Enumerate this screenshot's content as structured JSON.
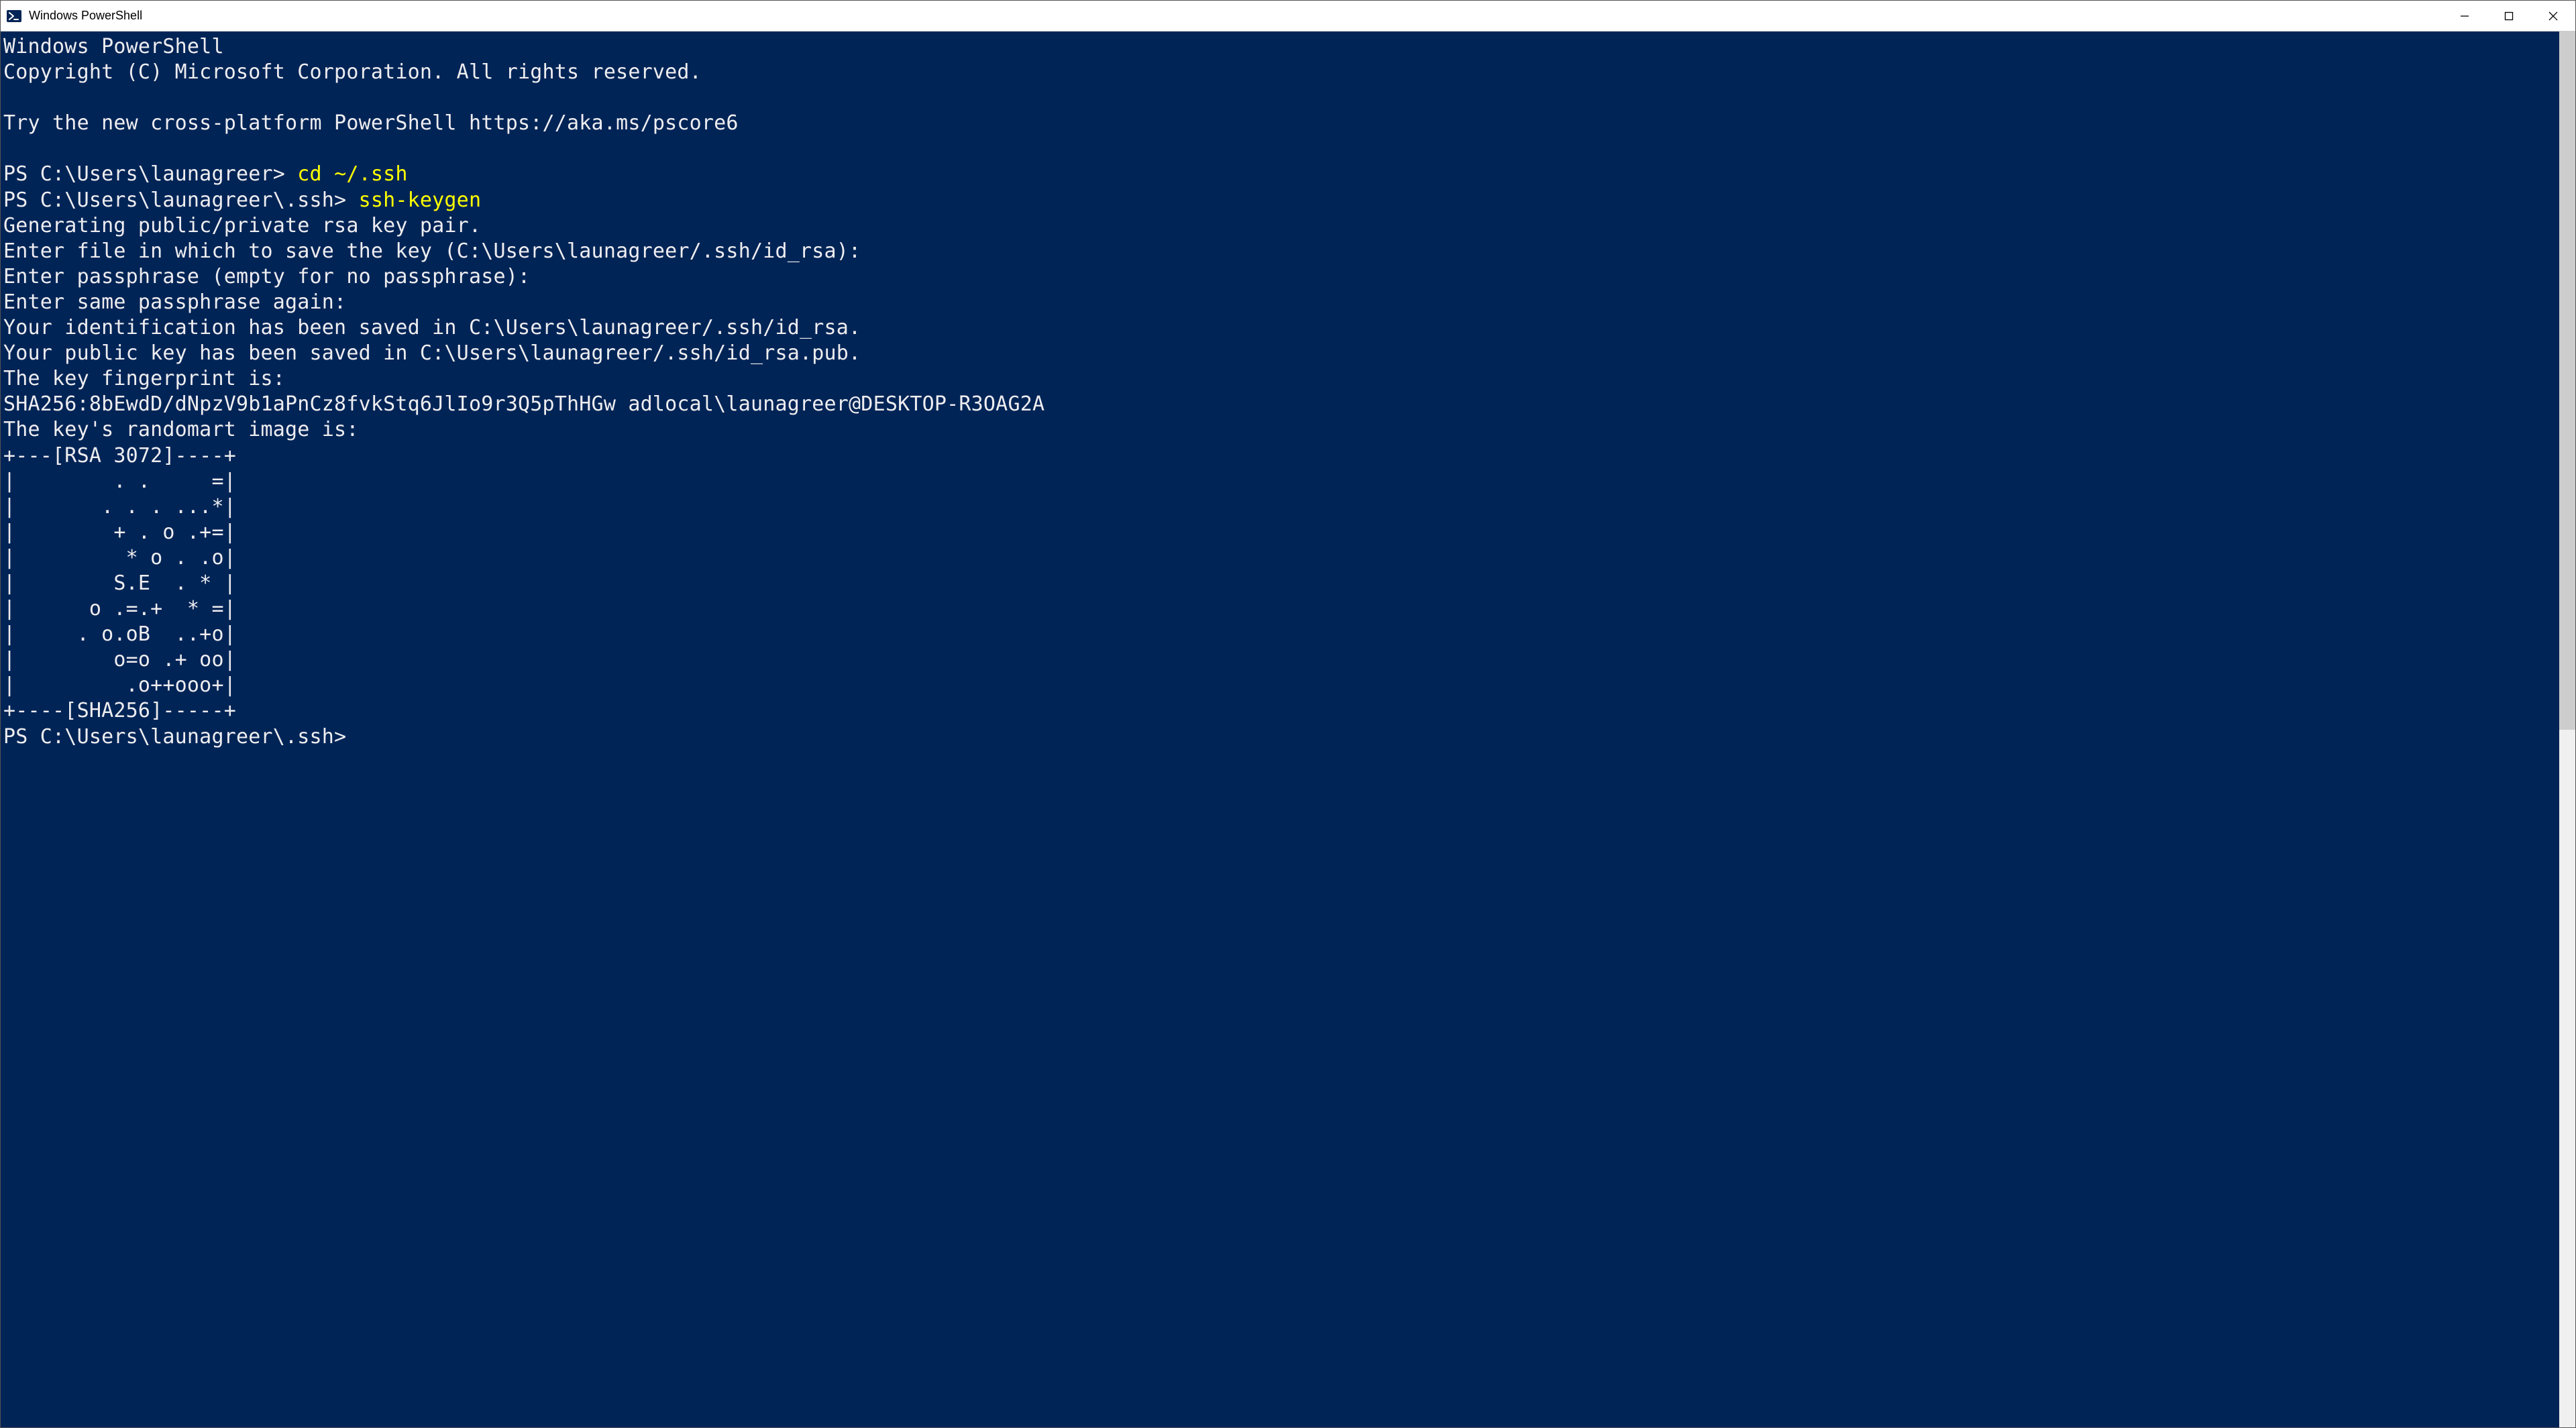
{
  "window": {
    "title": "Windows PowerShell"
  },
  "terminal": {
    "banner_line1": "Windows PowerShell",
    "banner_line2": "Copyright (C) Microsoft Corporation. All rights reserved.",
    "try_line": "Try the new cross-platform PowerShell https://aka.ms/pscore6",
    "prompt1_prefix": "PS C:\\Users\\launagreer> ",
    "cmd1": "cd ~/.ssh",
    "prompt2_prefix": "PS C:\\Users\\launagreer\\.ssh> ",
    "cmd2": "ssh-keygen",
    "out1": "Generating public/private rsa key pair.",
    "out2": "Enter file in which to save the key (C:\\Users\\launagreer/.ssh/id_rsa):",
    "out3": "Enter passphrase (empty for no passphrase):",
    "out4": "Enter same passphrase again:",
    "out5": "Your identification has been saved in C:\\Users\\launagreer/.ssh/id_rsa.",
    "out6": "Your public key has been saved in C:\\Users\\launagreer/.ssh/id_rsa.pub.",
    "out7": "The key fingerprint is:",
    "out8": "SHA256:8bEwdD/dNpzV9b1aPnCz8fvkStq6JlIo9r3Q5pThHGw adlocal\\launagreer@DESKTOP-R3OAG2A",
    "out9": "The key's randomart image is:",
    "art0": "+---[RSA 3072]----+",
    "art1": "|        . .     =|",
    "art2": "|       . . . ...*|",
    "art3": "|        + . o .+=|",
    "art4": "|         * o . .o|",
    "art5": "|        S.E  . * |",
    "art6": "|      o .=.+  * =|",
    "art7": "|     . o.oB  ..+o|",
    "art8": "|        o=o .+ oo|",
    "art9": "|         .o++ooo+|",
    "art10": "+----[SHA256]-----+",
    "prompt3": "PS C:\\Users\\launagreer\\.ssh> "
  }
}
